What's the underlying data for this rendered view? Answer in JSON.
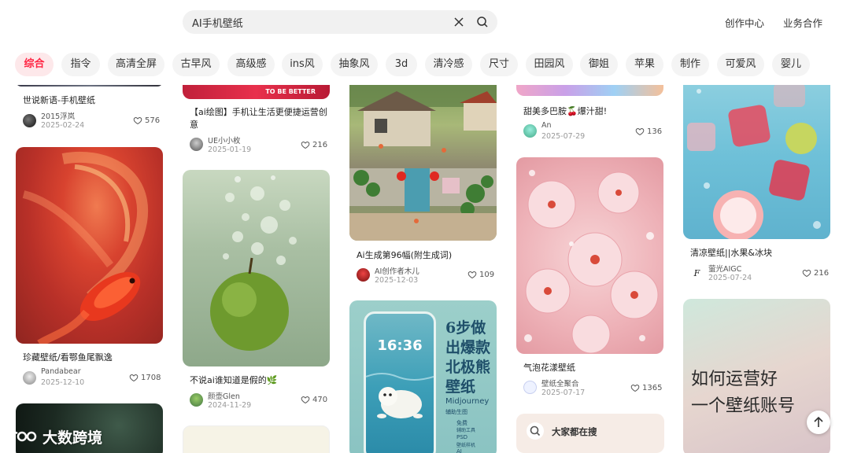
{
  "search": {
    "value": "AI手机壁纸"
  },
  "header": {
    "creator_center": "创作中心",
    "business": "业务合作"
  },
  "tabs": [
    "综合",
    "指令",
    "高清全屏",
    "古早风",
    "高级感",
    "ins风",
    "抽象风",
    "3d",
    "清冷感",
    "尺寸",
    "田园风",
    "御姐",
    "苹果",
    "制作",
    "可爱风",
    "婴儿"
  ],
  "active_tab": "综合",
  "cards": [
    {
      "title": "世说新语-手机壁纸",
      "author": "2015浮岚",
      "date": "2025-02-24",
      "likes": "576"
    },
    {
      "title": "珍藏壁纸/看鄂鱼尾飘逸",
      "author": "Pandabear",
      "date": "2025-12-10",
      "likes": "1708"
    },
    {
      "title": "【ai绘图】手机让生活更便捷运营创意",
      "author": "UE小小枚",
      "date": "2025-01-19",
      "likes": "216",
      "pic_text": "TO BE BETTER"
    },
    {
      "title": "不说ai谁知道是假的🌿",
      "author": "颜壶Glen",
      "date": "2024-11-29",
      "likes": "470"
    },
    {
      "title": "Ai生成第96幅(附生成词)",
      "author": "AI创作者木儿",
      "date": "2025-12-03",
      "likes": "109"
    },
    {
      "title": "",
      "author": "",
      "date": "",
      "likes": "",
      "poster": {
        "big": [
          "6步做",
          "出爆款",
          "北极熊",
          "壁纸"
        ],
        "sub": "Midjourney",
        "small": "辅助生图",
        "time": "16:36",
        "list": [
          "免费",
          "辅助工具",
          "PSD",
          "壁纸样机",
          "AI",
          "壁纸生成"
        ]
      }
    },
    {
      "title": "甜美多巴胺🍒爆汁甜!",
      "author": "An",
      "date": "2025-07-29",
      "likes": "136"
    },
    {
      "title": "气泡花漾壁纸",
      "author": "壁纸全聚合",
      "date": "2025-07-17",
      "likes": "1365"
    },
    {
      "title": "清凉壁纸||水果&冰块",
      "author": "萤光AIGC",
      "date": "2025-07-24",
      "likes": "216"
    },
    {
      "title": "",
      "author": "",
      "date": "",
      "likes": "",
      "pic_text": [
        "如何运营好",
        "一个壁纸账号"
      ]
    }
  ],
  "hot_search": {
    "label": "大家都在搜"
  },
  "watermark": "大数跨境",
  "colors": {
    "accent": "#ff2442",
    "accent_bg": "#fde8ea",
    "tab_bg": "#f4f4f4"
  }
}
